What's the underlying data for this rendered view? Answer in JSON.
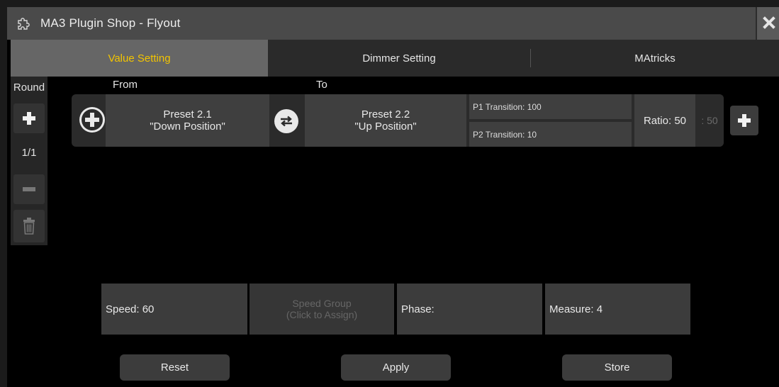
{
  "window": {
    "title": "MA3 Plugin Shop - Flyout",
    "icons": {
      "title": "puzzle-icon",
      "close": "close-icon"
    }
  },
  "tabs": [
    {
      "label": "Value Setting",
      "active": true
    },
    {
      "label": "Dimmer Setting",
      "active": false
    },
    {
      "label": "MAtricks",
      "active": false
    }
  ],
  "left_strip": {
    "round_label": "Round",
    "count": "1/1",
    "icons": [
      "plus-icon",
      "minus-icon",
      "trash-icon"
    ]
  },
  "preset_row": {
    "from_label": "From",
    "to_label": "To",
    "from_preset": {
      "line1": "Preset 2.1",
      "line2": "\"Down Position\""
    },
    "to_preset": {
      "line1": "Preset 2.2",
      "line2": "\"Up Position\""
    },
    "p1_transition": "P1 Transition: 100",
    "p2_transition": "P2 Transition: 10",
    "ratio": "Ratio: 50",
    "ratio_second": ": 50",
    "icons": [
      "add-circle-icon",
      "swap-icon",
      "plus-icon"
    ]
  },
  "settings": {
    "speed": "Speed: 60",
    "speed_group_line1": "Speed Group",
    "speed_group_line2": "(Click to Assign)",
    "phase": "Phase:",
    "measure": "Measure: 4"
  },
  "actions": {
    "reset": "Reset",
    "apply": "Apply",
    "store": "Store"
  },
  "colors": {
    "accent": "#f3c400",
    "background": "#000000",
    "button": "#3f3f3f",
    "titlebar": "#4a4a4a"
  }
}
